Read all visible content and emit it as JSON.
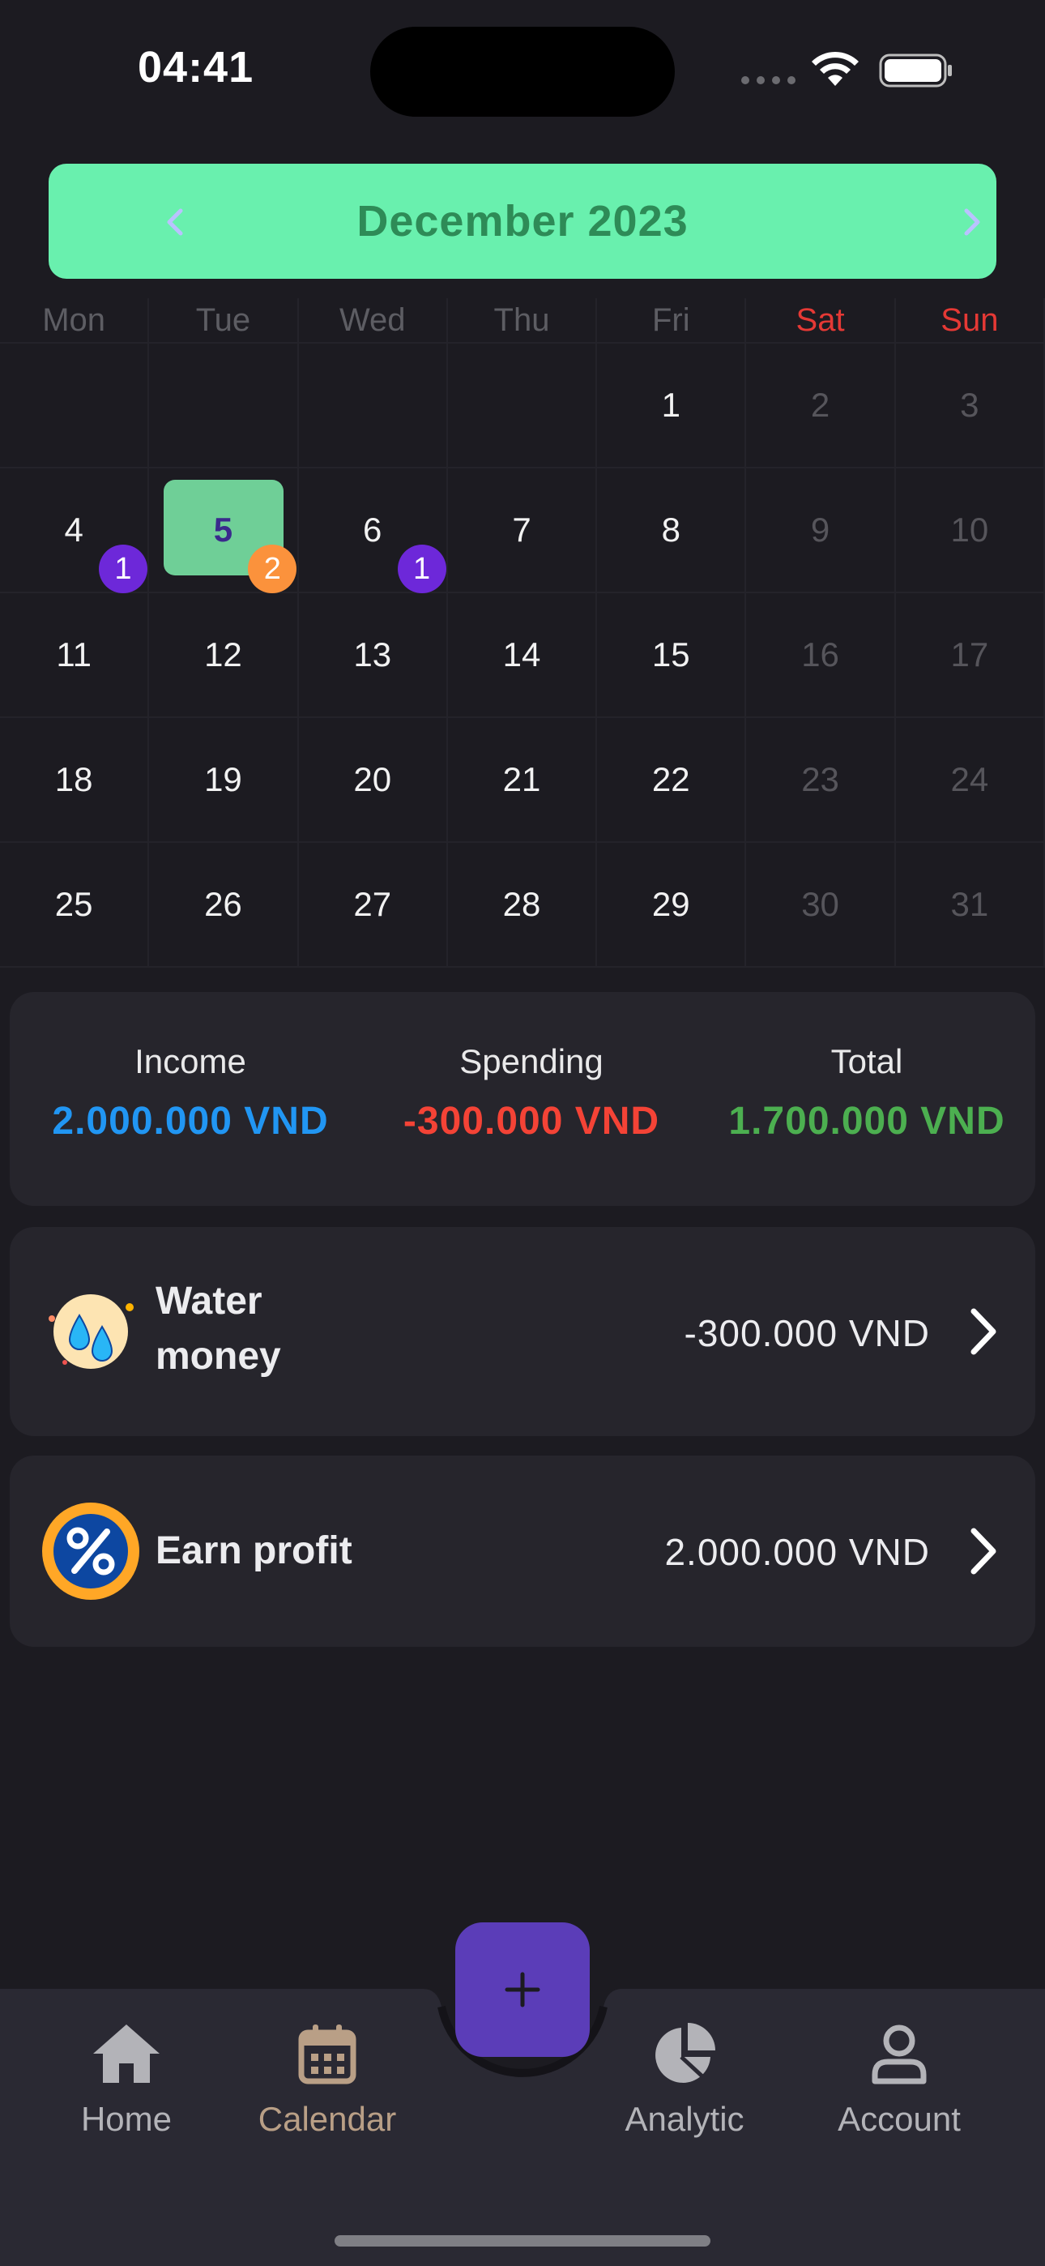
{
  "status_bar": {
    "time": "04:41"
  },
  "header": {
    "month_title": "December 2023"
  },
  "weekdays": [
    "Mon",
    "Tue",
    "Wed",
    "Thu",
    "Fri",
    "Sat",
    "Sun"
  ],
  "calendar": {
    "rows": [
      [
        "",
        "",
        "",
        "",
        "1",
        "2",
        "3"
      ],
      [
        "4",
        "5",
        "6",
        "7",
        "8",
        "9",
        "10"
      ],
      [
        "11",
        "12",
        "13",
        "14",
        "15",
        "16",
        "17"
      ],
      [
        "18",
        "19",
        "20",
        "21",
        "22",
        "23",
        "24"
      ],
      [
        "25",
        "26",
        "27",
        "28",
        "29",
        "30",
        "31"
      ]
    ],
    "selected_day": "5",
    "badges": {
      "d4": "1",
      "d5": "2",
      "d6": "1"
    }
  },
  "summary": {
    "income_label": "Income",
    "income_value": "2.000.000 VND",
    "spending_label": "Spending",
    "spending_value": "-300.000 VND",
    "total_label": "Total",
    "total_value": "1.700.000 VND"
  },
  "transactions": [
    {
      "name_line1": "Water",
      "name_line2": "money",
      "amount": "-300.000 VND",
      "icon": "water-drops-icon"
    },
    {
      "name": "Earn profit",
      "amount": "2.000.000 VND",
      "icon": "percent-badge-icon"
    }
  ],
  "bottom_nav": {
    "home": "Home",
    "calendar": "Calendar",
    "analytic": "Analytic",
    "account": "Account",
    "active": "calendar"
  },
  "colors": {
    "background": "#1c1b21",
    "card": "#26252c",
    "header_green": "#69f0ae",
    "income_blue": "#2196f3",
    "spending_red": "#f44336",
    "total_green": "#4caf50",
    "fab_purple": "#5b3db8"
  }
}
